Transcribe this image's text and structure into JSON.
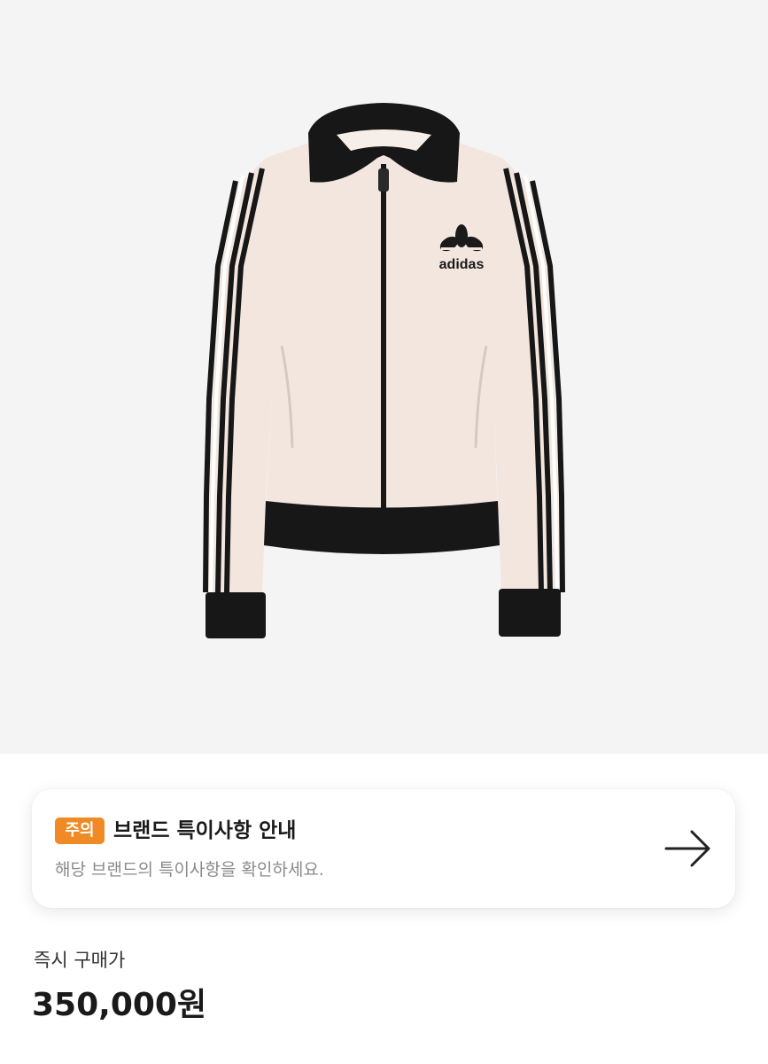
{
  "product": {
    "image_alt": "adidas track jacket",
    "logo_text": "adidas",
    "jacket_color": "#f3e6df",
    "trim_color": "#171717"
  },
  "notice": {
    "badge": "주의",
    "badge_color": "#f08a24",
    "title": "브랜드 특이사항 안내",
    "subtitle": "해당 브랜드의 특이사항을 확인하세요.",
    "arrow_icon": "arrow-right-icon"
  },
  "price": {
    "label": "즉시 구매가",
    "value": "350,000원"
  }
}
